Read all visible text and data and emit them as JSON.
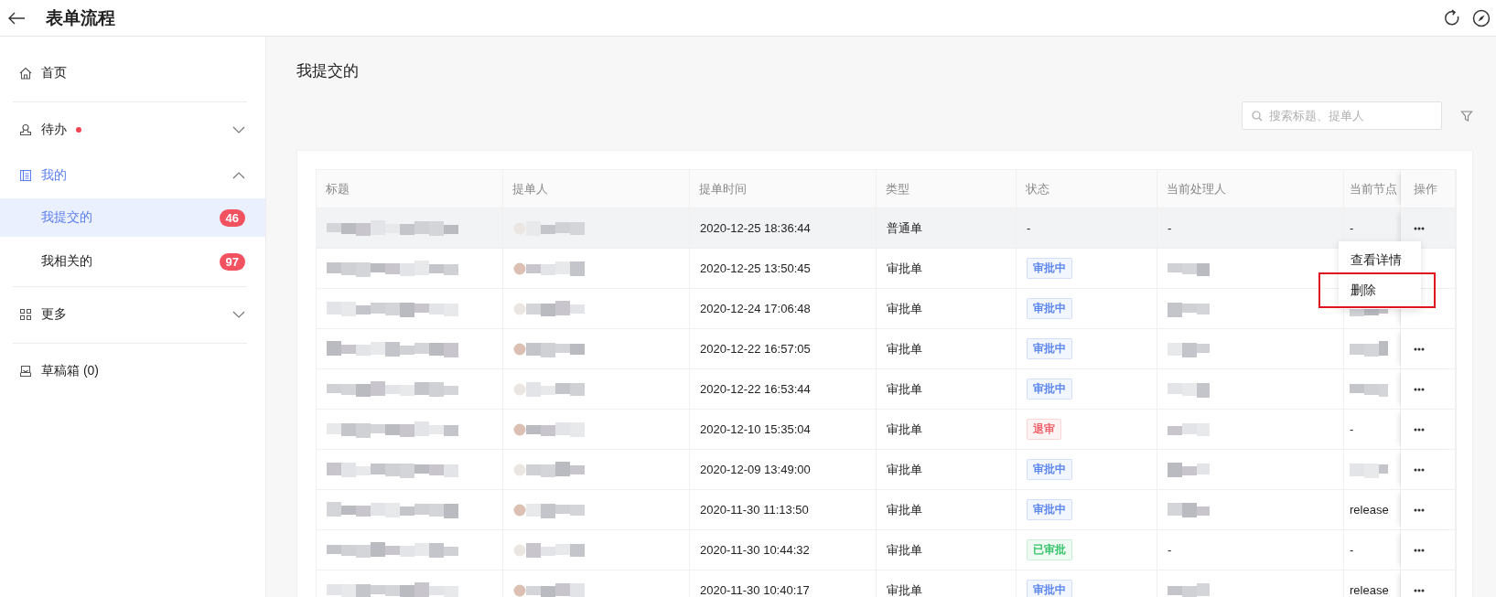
{
  "header": {
    "title": "表单流程"
  },
  "sidebar": {
    "sections": [
      {
        "items": [
          {
            "label": "首页",
            "selected": false
          }
        ]
      },
      {
        "items": [
          {
            "label": "待办",
            "selected": false,
            "dot": true,
            "expanded": false
          },
          {
            "label": "我的",
            "selected": false,
            "expanded": true,
            "children": [
              {
                "label": "我提交的",
                "badge": "46",
                "selected": true
              },
              {
                "label": "我相关的",
                "badge": "97",
                "selected": false
              }
            ]
          }
        ]
      },
      {
        "items": [
          {
            "label": "更多",
            "selected": false,
            "expanded": false
          }
        ]
      },
      {
        "items": [
          {
            "label": "草稿箱 (0)",
            "selected": false
          }
        ]
      }
    ]
  },
  "page_title": "我提交的",
  "search": {
    "placeholder": "搜索标题、提单人"
  },
  "table": {
    "columns": [
      "标题",
      "提单人",
      "提单时间",
      "类型",
      "状态",
      "当前处理人",
      "当前节点",
      "操作"
    ],
    "rows": [
      {
        "hovered": true,
        "more": true,
        "title": {
          "kind": "redacted"
        },
        "submitter": {
          "kind": "redacted"
        },
        "time": "2020-12-25 18:36:44",
        "type": "普通单",
        "status": {
          "kind": "text",
          "text": "-"
        },
        "handler": {
          "kind": "text",
          "text": "-"
        },
        "node": {
          "kind": "text",
          "text": "-"
        }
      },
      {
        "hovered": false,
        "more": false,
        "title": {
          "kind": "redacted"
        },
        "submitter": {
          "kind": "redacted"
        },
        "time": "2020-12-25 13:50:45",
        "type": "审批单",
        "status": {
          "kind": "tag",
          "text": "审批中",
          "color": "#5b86f0"
        },
        "handler": {
          "kind": "redacted"
        },
        "node": {
          "kind": "none"
        }
      },
      {
        "hovered": false,
        "more": false,
        "title": {
          "kind": "redacted"
        },
        "submitter": {
          "kind": "redacted"
        },
        "time": "2020-12-24 17:06:48",
        "type": "审批单",
        "status": {
          "kind": "tag",
          "text": "审批中",
          "color": "#5b86f0"
        },
        "handler": {
          "kind": "redacted"
        },
        "node": {
          "kind": "redacted"
        }
      },
      {
        "hovered": false,
        "more": true,
        "title": {
          "kind": "redacted"
        },
        "submitter": {
          "kind": "redacted"
        },
        "time": "2020-12-22 16:57:05",
        "type": "审批单",
        "status": {
          "kind": "tag",
          "text": "审批中",
          "color": "#5b86f0"
        },
        "handler": {
          "kind": "redacted"
        },
        "node": {
          "kind": "redacted"
        }
      },
      {
        "hovered": false,
        "more": true,
        "title": {
          "kind": "redacted"
        },
        "submitter": {
          "kind": "redacted"
        },
        "time": "2020-12-22 16:53:44",
        "type": "审批单",
        "status": {
          "kind": "tag",
          "text": "审批中",
          "color": "#5b86f0"
        },
        "handler": {
          "kind": "redacted"
        },
        "node": {
          "kind": "redacted"
        }
      },
      {
        "hovered": false,
        "more": true,
        "title": {
          "kind": "redacted"
        },
        "submitter": {
          "kind": "redacted"
        },
        "time": "2020-12-10 15:35:04",
        "type": "审批单",
        "status": {
          "kind": "tag",
          "text": "退审",
          "color": "#f0616a"
        },
        "handler": {
          "kind": "redacted"
        },
        "node": {
          "kind": "text",
          "text": "-"
        }
      },
      {
        "hovered": false,
        "more": true,
        "title": {
          "kind": "redacted"
        },
        "submitter": {
          "kind": "redacted"
        },
        "time": "2020-12-09 13:49:00",
        "type": "审批单",
        "status": {
          "kind": "tag",
          "text": "审批中",
          "color": "#5b86f0"
        },
        "handler": {
          "kind": "redacted"
        },
        "node": {
          "kind": "redacted"
        }
      },
      {
        "hovered": false,
        "more": true,
        "title": {
          "kind": "redacted"
        },
        "submitter": {
          "kind": "redacted"
        },
        "time": "2020-11-30 11:13:50",
        "type": "审批单",
        "status": {
          "kind": "tag",
          "text": "审批中",
          "color": "#5b86f0"
        },
        "handler": {
          "kind": "redacted"
        },
        "node": {
          "kind": "text",
          "text": "release"
        }
      },
      {
        "hovered": false,
        "more": true,
        "title": {
          "kind": "redacted"
        },
        "submitter": {
          "kind": "redacted"
        },
        "time": "2020-11-30 10:44:32",
        "type": "审批单",
        "status": {
          "kind": "tag",
          "text": "已审批",
          "color": "#35c46a"
        },
        "handler": {
          "kind": "text",
          "text": "-"
        },
        "node": {
          "kind": "text",
          "text": "-"
        }
      },
      {
        "hovered": false,
        "more": true,
        "title": {
          "kind": "redacted"
        },
        "submitter": {
          "kind": "redacted"
        },
        "time": "2020-11-30 10:40:17",
        "type": "审批单",
        "status": {
          "kind": "tag",
          "text": "审批中",
          "color": "#5b86f0"
        },
        "handler": {
          "kind": "redacted"
        },
        "node": {
          "kind": "text",
          "text": "release"
        }
      }
    ]
  },
  "action_menu": {
    "items": [
      {
        "label": "查看详情",
        "outlined": false
      },
      {
        "label": "删除",
        "outlined": true
      }
    ]
  }
}
